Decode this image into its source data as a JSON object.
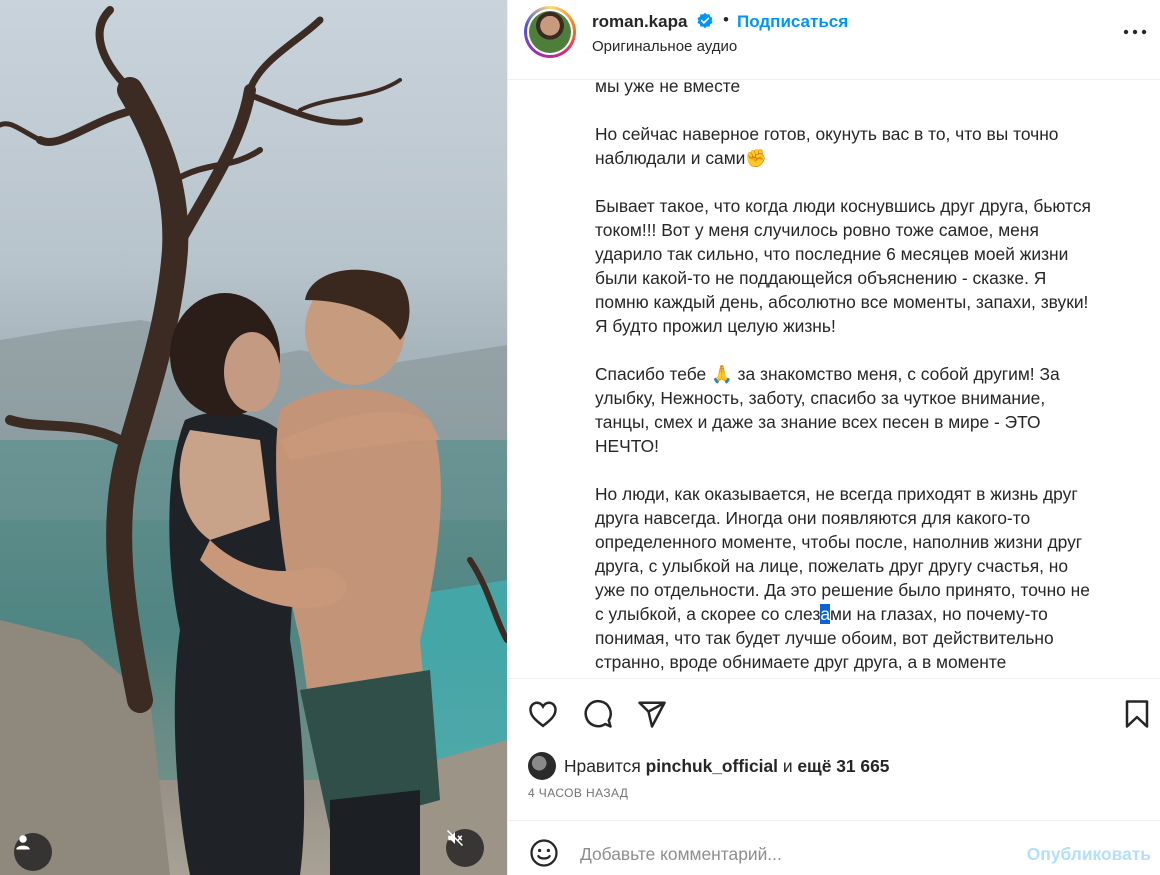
{
  "post": {
    "username": "roman.kapa",
    "verified": true,
    "dot": "•",
    "follow_label": "Подписаться",
    "audio_label": "Оригинальное аудио",
    "more_icon": "more-horizontal-icon"
  },
  "caption": {
    "paragraphs": [
      {
        "lines": [
          "мы уже не вместе"
        ]
      },
      {
        "lines": [
          "Но сейчас наверное готов, окунуть вас в то, что вы точно",
          "наблюдали и сами✊"
        ]
      },
      {
        "lines": [
          "Бывает такое, что когда люди коснувшись друг друга, бьются",
          "током!!! Вот у меня случилось ровно тоже самое, меня",
          "ударило так сильно, что последние 6 месяцев моей жизни",
          "были какой-то не поддающейся объяснению - сказке. Я",
          "помню каждый день, абсолютно все моменты, запахи, звуки!",
          "Я будто прожил целую жизнь!"
        ]
      },
      {
        "lines": [
          "Спасибо тебе 🙏 за знакомство меня, с собой другим! За",
          "улыбку, Нежность, заботу, спасибо за чуткое внимание,",
          "танцы, смех и даже за знание всех песен в мире - ЭТО",
          "НЕЧТО!"
        ]
      },
      {
        "lines": [
          "Но люди, как оказывается, не всегда приходят в жизнь друг",
          "друга навсегда. Иногда они появляются для какого-то",
          "определенного моменте, чтобы после, наполнив жизни друг",
          "друга, с улыбкой на лице, пожелать друг другу счастья, но",
          "уже по отдельности. Да это решение было принято, точно не"
        ]
      }
    ],
    "selected_line": {
      "before": "с улыбкой, а скорее со слез",
      "selected": "а",
      "after": "ми на глазах, но почему-то"
    },
    "tail_lines": [
      "понимая, что так будет лучше обоим, вот действительно",
      "странно, вроде обнимаете друг друга, а в моменте"
    ]
  },
  "actions": {
    "like_icon": "heart-icon",
    "comment_icon": "comment-icon",
    "share_icon": "share-icon",
    "save_icon": "bookmark-icon"
  },
  "likes": {
    "prefix": "Нравится",
    "user": "pinchuk_official",
    "conj": "и",
    "count": "ещё 31 665"
  },
  "timestamp": "4 ЧАСОВ НАЗАД",
  "comment": {
    "placeholder": "Добавьте комментарий...",
    "post_label": "Опубликовать"
  },
  "colors": {
    "accent": "#0095f6",
    "post_disabled": "#b2dffc",
    "text": "#262626",
    "muted": "#737373"
  }
}
